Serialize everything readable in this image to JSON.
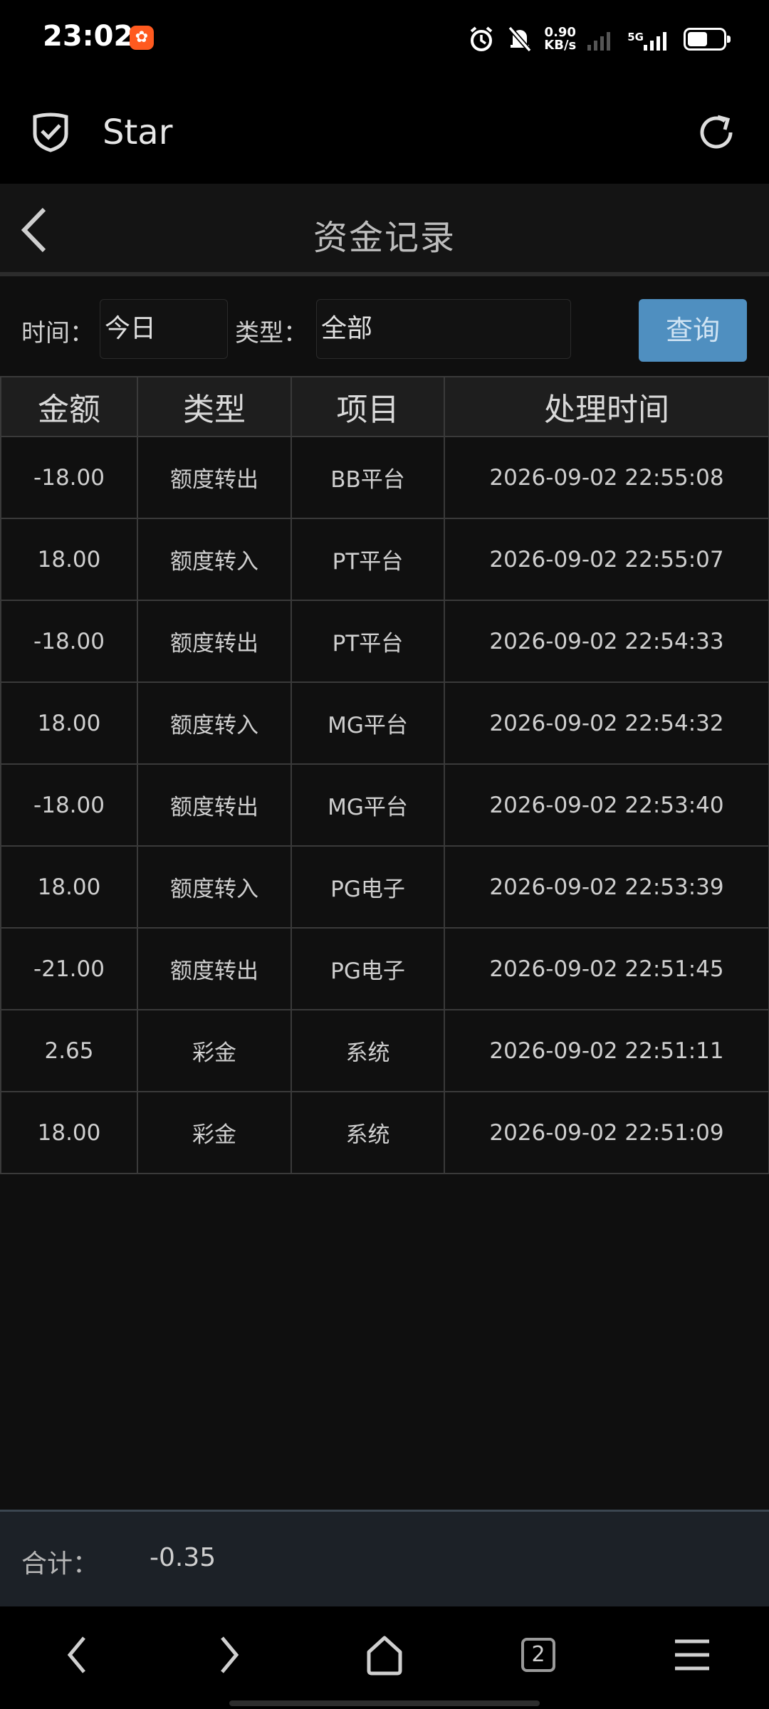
{
  "status_bar": {
    "time": "23:02",
    "app_icon": "app-notification-icon",
    "net_speed_value": "0.90",
    "net_speed_unit": "KB/s",
    "network": "5G"
  },
  "browser": {
    "site_name": "Star",
    "icons": {
      "site": "shield-check-icon",
      "refresh": "refresh-icon"
    }
  },
  "page": {
    "title": "资金记录",
    "back_icon": "chevron-left-icon"
  },
  "filters": {
    "time_label": "时间：",
    "time_value": "今日",
    "type_label": "类型：",
    "type_value": "全部",
    "query_button": "查询"
  },
  "table": {
    "headers": [
      "金额",
      "类型",
      "项目",
      "处理时间"
    ],
    "rows": [
      [
        "-18.00",
        "额度转出",
        "BB平台",
        "2026-09-02 22:55:08"
      ],
      [
        "18.00",
        "额度转入",
        "PT平台",
        "2026-09-02 22:55:07"
      ],
      [
        "-18.00",
        "额度转出",
        "PT平台",
        "2026-09-02 22:54:33"
      ],
      [
        "18.00",
        "额度转入",
        "MG平台",
        "2026-09-02 22:54:32"
      ],
      [
        "-18.00",
        "额度转出",
        "MG平台",
        "2026-09-02 22:53:40"
      ],
      [
        "18.00",
        "额度转入",
        "PG电子",
        "2026-09-02 22:53:39"
      ],
      [
        "-21.00",
        "额度转出",
        "PG电子",
        "2026-09-02 22:51:45"
      ],
      [
        "2.65",
        "彩金",
        "系统",
        "2026-09-02 22:51:11"
      ],
      [
        "18.00",
        "彩金",
        "系统",
        "2026-09-02 22:51:09"
      ]
    ]
  },
  "total": {
    "label": "合计：",
    "value": "-0.35"
  },
  "bottom_nav": {
    "tab_count": "2",
    "icons": [
      "chevron-left-icon",
      "chevron-right-icon",
      "home-icon",
      "tabs-icon",
      "menu-icon"
    ]
  },
  "colors": {
    "background": "#0f0f0f",
    "query_button": "#4f8fc0",
    "total_bar": "#1c2127"
  }
}
